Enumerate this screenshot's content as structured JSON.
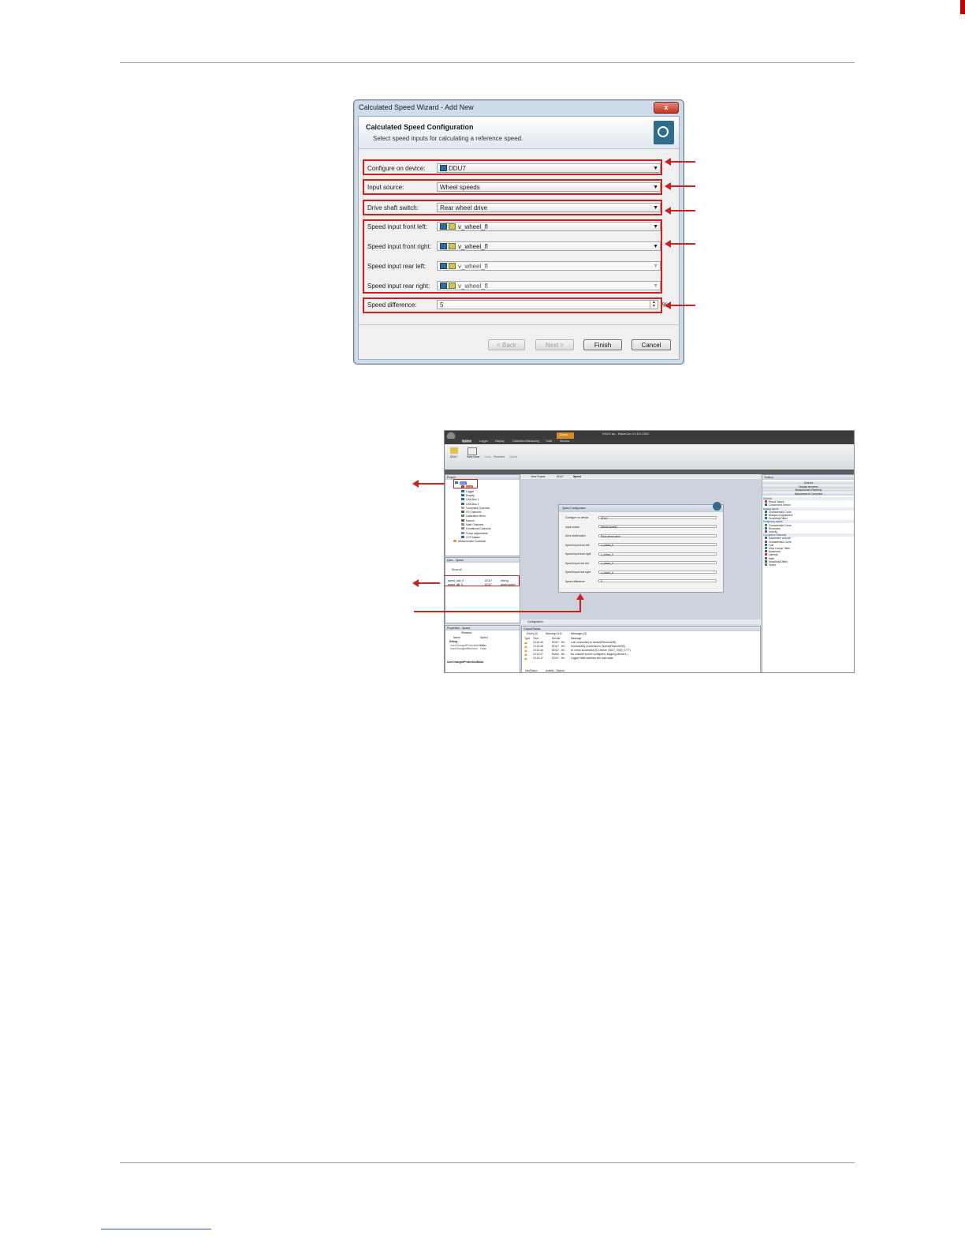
{
  "wizard": {
    "window_title": "Calculated Speed Wizard - Add New",
    "close_glyph": "x",
    "header_title": "Calculated Speed Configuration",
    "header_subtitle": "Select speed inputs for calculating a reference speed.",
    "fields": {
      "configure_on_device": {
        "label": "Configure on device:",
        "value": "DDU7"
      },
      "input_source": {
        "label": "Input source:",
        "value": "Wheel speeds"
      },
      "drive_shaft_switch": {
        "label": "Drive shaft switch:",
        "value": "Rear wheel drive"
      },
      "speed_input_front_left": {
        "label": "Speed input front left:",
        "value": "v_wheel_fl"
      },
      "speed_input_front_right": {
        "label": "Speed input front right:",
        "value": "v_wheel_fl"
      },
      "speed_input_rear_left": {
        "label": "Speed input rear left:",
        "value": "v_wheel_fl"
      },
      "speed_input_rear_right": {
        "label": "Speed input rear right:",
        "value": "v_wheel_fl"
      },
      "speed_difference": {
        "label": "Speed difference:",
        "value": "5",
        "unit": "%"
      }
    },
    "buttons": {
      "back": "< Back",
      "next": "Next >",
      "finish": "Finish",
      "cancel": "Cancel"
    }
  },
  "app": {
    "title": "DDU7.rlp - RaceCon V2.5.0.2022",
    "context_tab": "Sensor",
    "tabs": [
      "System",
      "Logger",
      "Display",
      "Calibration/Measuring",
      "Tools",
      "Window"
    ],
    "ribbon_buttons": [
      "DDU7",
      "Save Node",
      "Undo",
      "Predefine",
      "Update"
    ],
    "project_panel": {
      "title": "Project",
      "items": [
        "DDU7",
        "DDU7",
        "Logger",
        "Display",
        "CAN-Bus 1",
        "CAN-Bus 2",
        "Computed Channels",
        "I/O Channels",
        "Calibration Items",
        "Macros",
        "Math Channels",
        "Conditional Channels",
        "Group adjustments",
        "CCP Master",
        "Measurement Container"
      ]
    },
    "data_panel": {
      "title": "Data - Speed",
      "show_all": "Show all",
      "rows": [
        {
          "name": "speed_calc_fl",
          "device": "DDU7",
          "type": "driving"
        },
        {
          "name": "speed_diff_fl",
          "device": "DDU7",
          "type": "wheel speed"
        }
      ]
    },
    "properties_panel": {
      "title": "Properties - Speed",
      "filter": "Windows",
      "columns": [
        "Name",
        "Speed"
      ],
      "group": "Debug",
      "rows": [
        {
          "name": "UserChangedProtectionMode",
          "value": "False"
        },
        {
          "name": "UserChangedAfterSave",
          "value": "False"
        }
      ],
      "footer": "UserChangedProtectionMode"
    },
    "doc_tabs": [
      "View Project",
      "DDU7",
      "Speed"
    ],
    "speed_configuration": {
      "title": "Speed Configuration",
      "fields": [
        {
          "label": "Configure on device",
          "value": "DDU7"
        },
        {
          "label": "Input source",
          "value": "Wheel speeds"
        },
        {
          "label": "Drive shaft switch",
          "value": "Rear wheel drive"
        },
        {
          "label": "Speed input front left",
          "value": "v_wheel_fl"
        },
        {
          "label": "Speed input front right",
          "value": "v_wheel_fl"
        },
        {
          "label": "Speed input rear left",
          "value": "v_wheel_fl"
        },
        {
          "label": "Speed input rear right",
          "value": "v_wheel_fl"
        },
        {
          "label": "Speed difference",
          "value": "5"
        }
      ]
    },
    "config_tab": "Configuration",
    "toolbox": {
      "title": "Toolbox",
      "bars": [
        "Devices",
        "Display elements",
        "Measurement Elements",
        "Measurement Computed"
      ],
      "groups": [
        {
          "name": "Generic",
          "items": [
            "Result Values",
            "Customized Sensor"
          ]
        },
        {
          "name": "Analog Inputs",
          "items": [
            "Characteristic Curve",
            "Multipoint Adjustment",
            "Sensitivity/Offset"
          ]
        },
        {
          "name": "Frequency Inputs",
          "items": [
            "Characteristic Curve",
            "Revolution",
            "Velocity"
          ]
        },
        {
          "name": "Computed Channels",
          "items": [
            "Adjustment channel",
            "Characteristic Curve",
            "Fuel",
            "Gear Lookup Table",
            "Hysteresis",
            "Lambda",
            "Math",
            "Sensitivity/Offset",
            "Speed"
          ]
        }
      ]
    },
    "output_panel": {
      "title": "Output/Status",
      "filters": [
        "Errors (0)",
        "Warnings (14)",
        "Messages (0)"
      ],
      "columns": [
        "Type",
        "Time",
        "Sender",
        "Message"
      ],
      "rows": [
        {
          "time": "10:10:46",
          "sender": "DDU7 - He...",
          "message": "Lost connection to device(Ethernet#35)."
        },
        {
          "time": "10:10:46",
          "sender": "DDU7 - He...",
          "message": "Successfully connected to device(Ethernet#35)."
        },
        {
          "time": "10:10:46",
          "sender": "DDU7 - He...",
          "message": "ID check successful (ID Device: DDU7_0000_0777)"
        },
        {
          "time": "10:10:47",
          "sender": "Robot - He...",
          "message": "No channel source configured, skipping device's..."
        },
        {
          "time": "10:10:47",
          "sender": "DDU7 - He...",
          "message": "Logger state switches into start state."
        }
      ],
      "bottom_tabs": [
        "Info/Status",
        "Activity - Started"
      ]
    }
  }
}
